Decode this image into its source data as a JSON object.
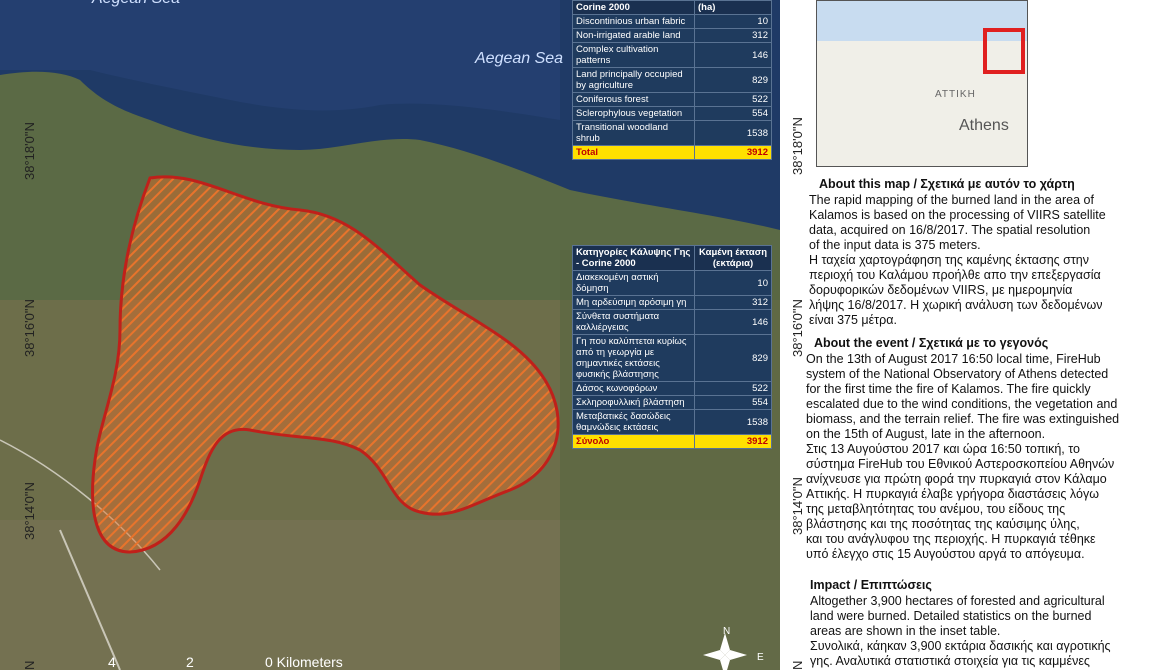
{
  "map": {
    "sea_labels": [
      "Aegean Sea",
      "Aegean Sea"
    ],
    "left_coords": [
      "38°18'0\"N",
      "38°16'0\"N",
      "38°14'0\"N",
      "N"
    ],
    "right_coords": [
      "38°18'0\"N",
      "38°16'0\"N",
      "38°14'0\"N",
      "N"
    ],
    "scale": {
      "ticks": [
        "4",
        "2",
        "0 Kilometers"
      ]
    },
    "compass": {
      "n": "N",
      "e": "E"
    }
  },
  "table_en": {
    "header": [
      "Corine 2000",
      "(ha)"
    ],
    "rows": [
      [
        "Discontinious urban fabric",
        "10"
      ],
      [
        "Non-irrigated arable land",
        "312"
      ],
      [
        "Complex cultivation patterns",
        "146"
      ],
      [
        "Land principally occupied by agriculture",
        "829"
      ],
      [
        "Coniferous forest",
        "522"
      ],
      [
        "Sclerophylous vegetation",
        "554"
      ],
      [
        "Transitional woodland shrub",
        "1538"
      ]
    ],
    "total": [
      "Total",
      "3912"
    ]
  },
  "table_gr": {
    "header": [
      "Κατηγορίες Κάλυψης Γης - Corine 2000",
      "Καμένη έκταση (εκτάρια)"
    ],
    "rows": [
      [
        "Διακεκομένη αστική δόμηση",
        "10"
      ],
      [
        "Μη αρδεύσιμη αρόσιμη γη",
        "312"
      ],
      [
        "Σύνθετα συστήματα καλλιέργειας",
        "146"
      ],
      [
        "Γη που καλύπτεται κυρίως από τη γεωργία με σημαντικές εκτάσεις φυσικής βλάστησης",
        "829"
      ],
      [
        "Δάσος κωνοφόρων",
        "522"
      ],
      [
        "Σκληροφυλλική βλάστηση",
        "554"
      ],
      [
        "Μεταβατικές δασώδεις θαμνώδεις εκτάσεις",
        "1538"
      ]
    ],
    "total": [
      "Σύνολο",
      "3912"
    ]
  },
  "inset": {
    "region": "ΑΤΤΙΚΗ",
    "city": "Athens"
  },
  "about_map": {
    "heading": "About this map / Σχετικά με αυτόν το χάρτη",
    "text": "The rapid mapping of the burned land in the area of\nKalamos is based on the processing of VIIRS satellite\ndata, acquired on 16/8/2017. The spatial resolution\nof the input data is 375 meters.\nΗ ταχεία χαρτογράφηση της καμένης έκτασης στην\nπεριοχή του Καλάμου προήλθε απο την επεξεργασία\nδορυφορικών δεδομένων VIIRS, με ημερομηνία\nλήψης 16/8/2017. Η χωρική ανάλυση των δεδομένων\nείναι 375 μέτρα."
  },
  "about_event": {
    "heading": "About the event / Σχετικά με το γεγονός",
    "text": "On the 13th of August 2017 16:50 local time, FireHub\nsystem of the National Observatory of Athens detected\nfor the first time the fire of Kalamos. The fire quickly\nescalated due to the wind conditions, the vegetation and\nbiomass, and the  terrain relief. The fire was extinguished\non the 15th of August, late in the afternoon.\nΣτις 13 Αυγούστου 2017 και ώρα 16:50 τοπική, το\nσύστημα FireHub του Εθνικού Αστεροσκοπείου Αθηνών\nανίχνευσε για πρώτη φορά την πυρκαγιά στον Κάλαμο\nΑττικής. Η πυρκαγιά έλαβε γρήγορα διαστάσεις λόγω\nτης μεταβλητότητας του ανέμου, του είδους της\n βλάστησης και της ποσότητας της καύσιμης ύλης,\nκαι του ανάγλυφου της περιοχής. Η πυρκαγιά τέθηκε\nυπό έλεγχο στις 15 Αυγούστου αργά το απόγευμα."
  },
  "impact": {
    "heading": "Impact / Επιπτώσεις",
    "text": "Altogether 3,900 hectares of forested and agricultural\nland were burned. Detailed statistics on the burned\nareas are shown in the inset table.\nΣυνολικά, κάηκαν 3,900 εκτάρια δασικής και αγροτικής\nγης. Αναλυτικά στατιστικά στοιχεία για τις  καμμένες"
  }
}
